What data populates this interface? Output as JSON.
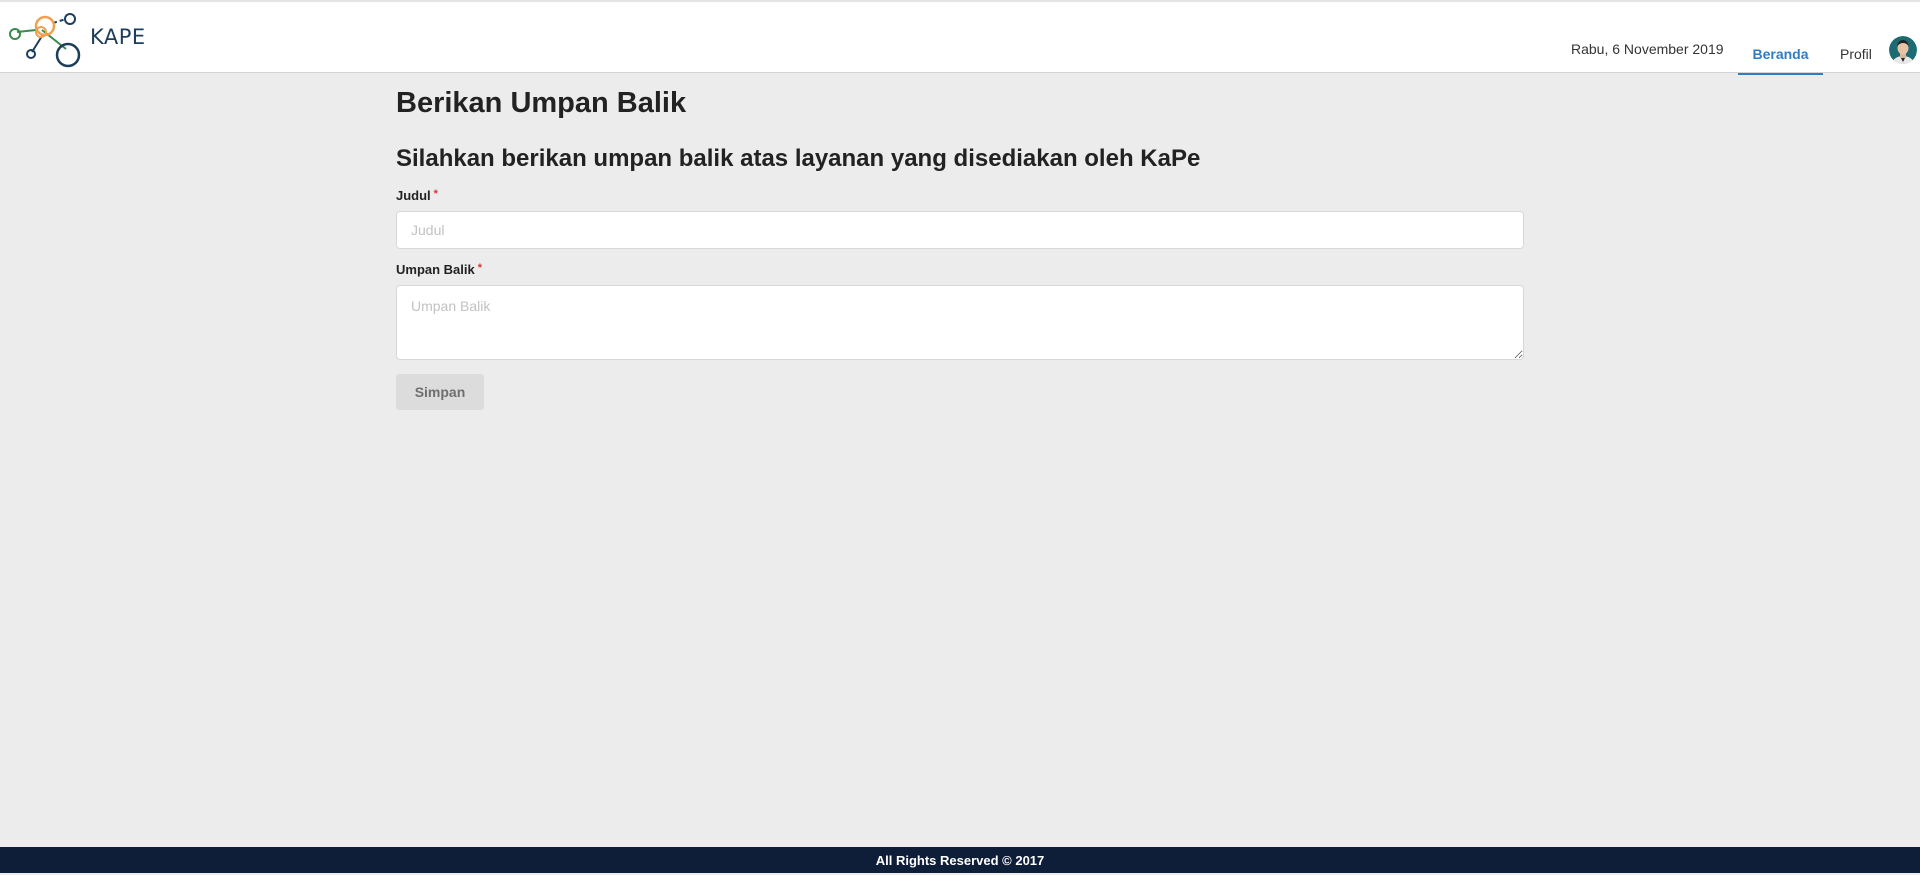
{
  "header": {
    "logo_text": "KAPE",
    "date": "Rabu, 6 November 2019",
    "nav": {
      "beranda": "Beranda",
      "profil": "Profil"
    }
  },
  "main": {
    "title": "Berikan Umpan Balik",
    "subtitle": "Silahkan berikan umpan balik atas layanan yang disediakan oleh KaPe",
    "fields": {
      "judul": {
        "label": "Judul",
        "required_mark": "*",
        "placeholder": "Judul",
        "value": ""
      },
      "umpan_balik": {
        "label": "Umpan Balik",
        "required_mark": "*",
        "placeholder": "Umpan Balik",
        "value": ""
      }
    },
    "save_label": "Simpan"
  },
  "footer": {
    "text": "All Rights Reserved © 2017"
  },
  "colors": {
    "accent": "#2f7dc4",
    "footer_bg": "#0f1e38",
    "page_bg": "#ececec",
    "required": "#dd3333"
  },
  "icons": {
    "logo": "molecule-logo-icon",
    "avatar": "user-avatar-icon"
  }
}
